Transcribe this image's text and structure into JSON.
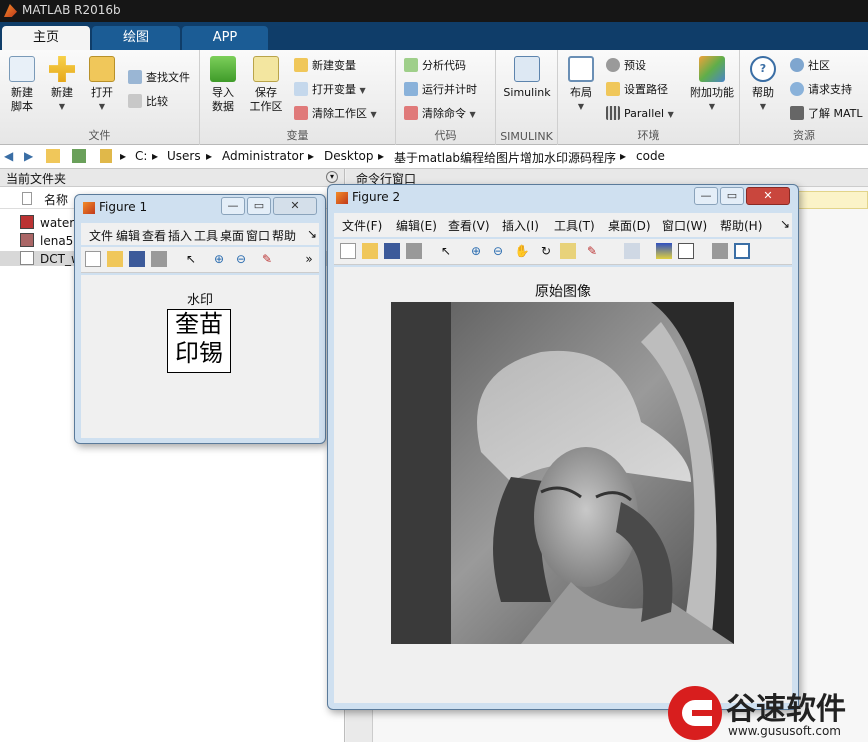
{
  "app": {
    "title": "MATLAB R2016b"
  },
  "tabs": [
    "主页",
    "绘图",
    "APP"
  ],
  "ribbon": {
    "groups": [
      "文件",
      "变量",
      "代码",
      "SIMULINK",
      "环境",
      "资源"
    ],
    "new_script": "新建\n脚本",
    "new": "新建",
    "open": "打开",
    "find_files": "查找文件",
    "compare": "比较",
    "import": "导入\n数据",
    "save_ws": "保存\n工作区",
    "new_var": "新建变量",
    "open_var": "打开变量",
    "clear_ws": "清除工作区",
    "analyze": "分析代码",
    "run_time": "运行并计时",
    "clear_cmd": "清除命令",
    "simulink": "Simulink",
    "layout": "布局",
    "prefs": "预设",
    "set_path": "设置路径",
    "parallel": "Parallel",
    "addons": "附加功能",
    "help": "帮助",
    "community": "社区",
    "request_support": "请求支持",
    "learn": "了解 MATL"
  },
  "address": {
    "path": [
      "C:",
      "Users",
      "Administrator",
      "Desktop",
      "基于matlab编程给图片增加水印源码程序",
      "code"
    ]
  },
  "left_pane": {
    "header": "当前文件夹",
    "col_name": "名称",
    "files": [
      "water",
      "lena5",
      "DCT_w"
    ]
  },
  "right_pane": {
    "header": "命令行窗口"
  },
  "figure1": {
    "title": "Figure 1",
    "menu": [
      "文件",
      "编辑",
      "查看",
      "插入",
      "工具",
      "桌面",
      "窗口",
      "帮助"
    ],
    "plot_title": "水印",
    "watermark_text": "奎苗\n印锡"
  },
  "figure2": {
    "title": "Figure 2",
    "menu": [
      "文件(F)",
      "编辑(E)",
      "查看(V)",
      "插入(I)",
      "工具(T)",
      "桌面(D)",
      "窗口(W)",
      "帮助(H)"
    ],
    "plot_title": "原始图像"
  },
  "watermark": {
    "brand": "谷速软件",
    "url": "www.gususoft.com",
    "color": "#d81e1e"
  }
}
